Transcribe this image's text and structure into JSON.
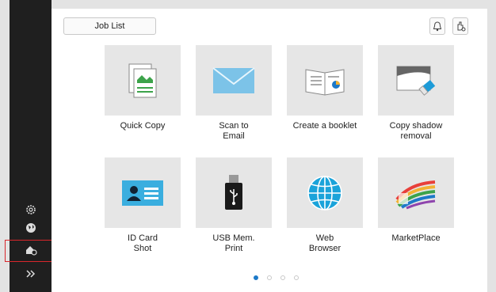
{
  "header": {
    "job_list_label": "Job List",
    "notification_icon": "bell-icon",
    "user_icon": "hand-icon"
  },
  "sidebar": {
    "items": [
      {
        "icon": "settings-icon"
      },
      {
        "icon": "globe-icon"
      },
      {
        "icon": "home-settings-icon",
        "highlighted": true
      },
      {
        "icon": "double-chevron-right-icon"
      }
    ],
    "highlight_color": "#d9262b"
  },
  "apps": [
    {
      "label": "Quick Copy",
      "icon": "quick-copy-icon"
    },
    {
      "label": "Scan to\nEmail",
      "icon": "email-envelope-icon"
    },
    {
      "label": "Create a booklet",
      "icon": "booklet-icon"
    },
    {
      "label": "Copy shadow\nremoval",
      "icon": "eraser-icon"
    },
    {
      "label": "ID Card\nShot",
      "icon": "id-card-icon"
    },
    {
      "label": "USB Mem.\nPrint",
      "icon": "usb-icon"
    },
    {
      "label": "Web\nBrowser",
      "icon": "globe-icon"
    },
    {
      "label": "MarketPlace",
      "icon": "marketplace-icon"
    }
  ],
  "pager": {
    "pages": 4,
    "current": 1
  },
  "colors": {
    "accent": "#1d79c8",
    "sidebar_bg": "#1f1f1f"
  }
}
